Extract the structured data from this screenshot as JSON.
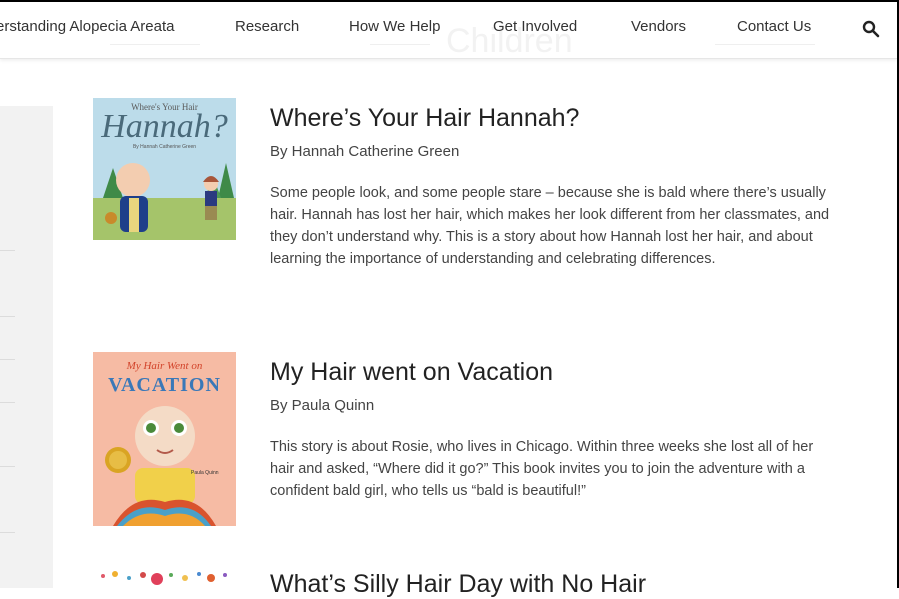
{
  "nav": {
    "items": [
      {
        "id": "understanding",
        "label": "erstanding Alopecia Areata"
      },
      {
        "id": "research",
        "label": "Research"
      },
      {
        "id": "help",
        "label": "How We Help"
      },
      {
        "id": "involved",
        "label": "Get Involved"
      },
      {
        "id": "vendors",
        "label": "Vendors"
      },
      {
        "id": "contact",
        "label": "Contact Us"
      }
    ],
    "search_icon": "search-icon"
  },
  "page": {
    "ghost_title": "Children"
  },
  "books": [
    {
      "cover_text": "Where's Your Hair",
      "cover_title": "Hannah?",
      "cover_byline": "By Hannah Catherine Green",
      "title": "Where’s Your Hair Hannah?",
      "author": "By Hannah Catherine Green",
      "description": "Some people look, and some people stare – because she is bald where there’s usually hair. Hannah has lost her hair, which makes her look different from her classmates, and they don’t understand why. This is a story about how Hannah lost her hair, and about learning the importance of understanding and celebrating differences."
    },
    {
      "cover_text": "My Hair Went on",
      "cover_title": "VACATION",
      "cover_author": "Paula Quinn",
      "title": "My Hair went on Vacation",
      "author": "By Paula Quinn",
      "description": "This story is about Rosie, who lives in Chicago. Within three weeks she lost all of her hair and asked, “Where did it go?” This book invites you to join the adventure with a confident bald girl, who tells us “bald is beautiful!”"
    },
    {
      "title": "What’s Silly Hair Day with No Hair"
    }
  ],
  "colors": {
    "accent": "#333333",
    "sidebar": "#f2f2f2"
  }
}
